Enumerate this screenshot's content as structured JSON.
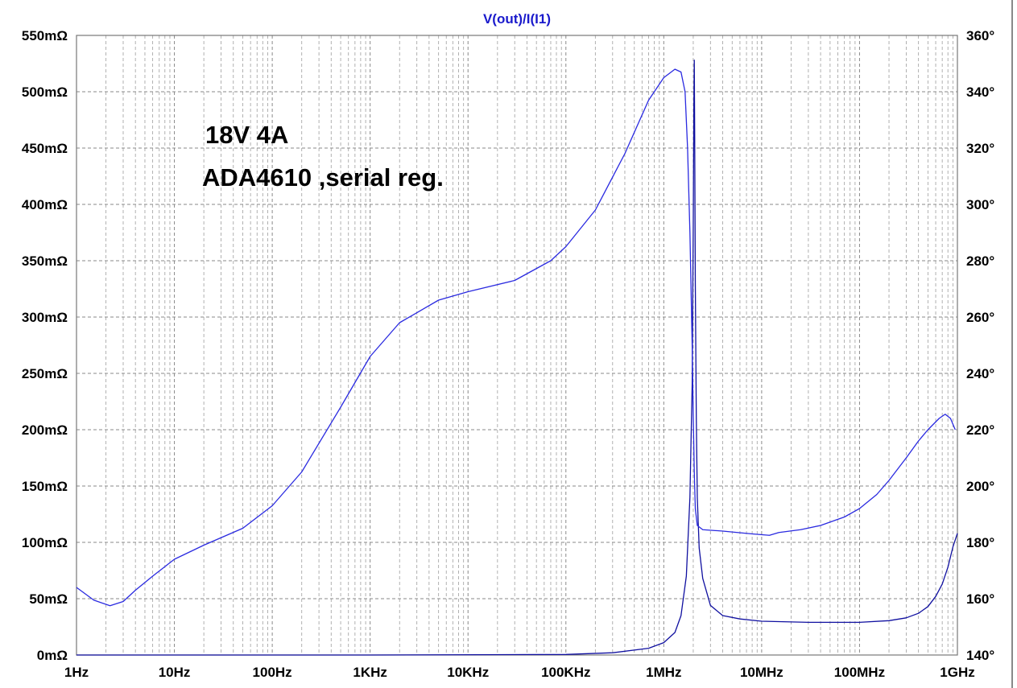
{
  "chart_data": {
    "type": "line",
    "title": "V(out)/I(I1)",
    "annotations": [
      "18V 4A",
      "ADA4610 ,serial reg."
    ],
    "x_scale": "log",
    "xlim": [
      1,
      1000000000
    ],
    "x_ticks": [
      {
        "value": 1,
        "label": "1Hz"
      },
      {
        "value": 10,
        "label": "10Hz"
      },
      {
        "value": 100,
        "label": "100Hz"
      },
      {
        "value": 1000,
        "label": "1KHz"
      },
      {
        "value": 10000,
        "label": "10KHz"
      },
      {
        "value": 100000,
        "label": "100KHz"
      },
      {
        "value": 1000000,
        "label": "1MHz"
      },
      {
        "value": 10000000,
        "label": "10MHz"
      },
      {
        "value": 100000000,
        "label": "100MHz"
      },
      {
        "value": 1000000000,
        "label": "1GHz"
      }
    ],
    "y_left": {
      "unit": "mΩ",
      "lim": [
        0,
        550
      ],
      "ticks": [
        {
          "value": 0,
          "label": "0mΩ"
        },
        {
          "value": 50,
          "label": "50mΩ"
        },
        {
          "value": 100,
          "label": "100mΩ"
        },
        {
          "value": 150,
          "label": "150mΩ"
        },
        {
          "value": 200,
          "label": "200mΩ"
        },
        {
          "value": 250,
          "label": "250mΩ"
        },
        {
          "value": 300,
          "label": "300mΩ"
        },
        {
          "value": 350,
          "label": "350mΩ"
        },
        {
          "value": 400,
          "label": "400mΩ"
        },
        {
          "value": 450,
          "label": "450mΩ"
        },
        {
          "value": 500,
          "label": "500mΩ"
        },
        {
          "value": 550,
          "label": "550mΩ"
        }
      ]
    },
    "y_right": {
      "unit": "°",
      "lim": [
        140,
        360
      ],
      "ticks": [
        {
          "value": 140,
          "label": "140°"
        },
        {
          "value": 160,
          "label": "160°"
        },
        {
          "value": 180,
          "label": "180°"
        },
        {
          "value": 200,
          "label": "200°"
        },
        {
          "value": 220,
          "label": "220°"
        },
        {
          "value": 240,
          "label": "240°"
        },
        {
          "value": 260,
          "label": "260°"
        },
        {
          "value": 280,
          "label": "280°"
        },
        {
          "value": 300,
          "label": "300°"
        },
        {
          "value": 320,
          "label": "320°"
        },
        {
          "value": 340,
          "label": "340°"
        },
        {
          "value": 360,
          "label": "360°"
        }
      ]
    },
    "grid": true,
    "series": [
      {
        "axis": "left",
        "color": "#1010a0",
        "style": "solid",
        "points": [
          [
            1,
            0
          ],
          [
            1000,
            0
          ],
          [
            100000,
            0.5
          ],
          [
            300000,
            2
          ],
          [
            700000,
            6
          ],
          [
            1000000,
            11
          ],
          [
            1300000,
            20
          ],
          [
            1500000,
            35
          ],
          [
            1700000,
            70
          ],
          [
            1850000,
            140
          ],
          [
            1950000,
            240
          ],
          [
            2000000,
            380
          ],
          [
            2030000,
            490
          ],
          [
            2050000,
            528
          ],
          [
            2070000,
            460
          ],
          [
            2100000,
            330
          ],
          [
            2150000,
            210
          ],
          [
            2200000,
            140
          ],
          [
            2300000,
            95
          ],
          [
            2500000,
            68
          ],
          [
            3000000,
            44
          ],
          [
            4000000,
            35
          ],
          [
            6000000,
            32
          ],
          [
            10000000,
            30
          ],
          [
            30000000,
            29
          ],
          [
            100000000,
            29
          ],
          [
            200000000,
            30.5
          ],
          [
            300000000,
            33
          ],
          [
            400000000,
            37
          ],
          [
            500000000,
            43
          ],
          [
            600000000,
            52
          ],
          [
            700000000,
            63
          ],
          [
            800000000,
            78
          ],
          [
            900000000,
            96
          ],
          [
            1000000000,
            108
          ]
        ]
      },
      {
        "axis": "right",
        "color": "#2a2ae0",
        "style": "solid",
        "points": [
          [
            1,
            164
          ],
          [
            1.5,
            159.5
          ],
          [
            2.2,
            157.5
          ],
          [
            3,
            159
          ],
          [
            4,
            163
          ],
          [
            6,
            168
          ],
          [
            10,
            174
          ],
          [
            20,
            179
          ],
          [
            50,
            185
          ],
          [
            100,
            193
          ],
          [
            200,
            205
          ],
          [
            500,
            228
          ],
          [
            1000,
            246
          ],
          [
            2000,
            258
          ],
          [
            5000,
            266
          ],
          [
            10000,
            269
          ],
          [
            30000,
            273
          ],
          [
            70000,
            280
          ],
          [
            100000,
            285
          ],
          [
            200000,
            298
          ],
          [
            400000,
            318
          ],
          [
            700000,
            337
          ],
          [
            1000000,
            345
          ],
          [
            1300000,
            348
          ],
          [
            1500000,
            347
          ],
          [
            1650000,
            340
          ],
          [
            1750000,
            320
          ],
          [
            1850000,
            290
          ],
          [
            1950000,
            250
          ],
          [
            2000000,
            225
          ],
          [
            2050000,
            205
          ],
          [
            2100000,
            192
          ],
          [
            2200000,
            186
          ],
          [
            2500000,
            184.5
          ],
          [
            4000000,
            184
          ],
          [
            8000000,
            183
          ],
          [
            12000000,
            182.5
          ],
          [
            15000000,
            183.5
          ],
          [
            25000000,
            184.5
          ],
          [
            40000000,
            186
          ],
          [
            70000000,
            189
          ],
          [
            100000000,
            192
          ],
          [
            150000000,
            197
          ],
          [
            200000000,
            202
          ],
          [
            300000000,
            210
          ],
          [
            400000000,
            216
          ],
          [
            500000000,
            220
          ],
          [
            650000000,
            224
          ],
          [
            750000000,
            225.5
          ],
          [
            850000000,
            224
          ],
          [
            950000000,
            220
          ]
        ]
      }
    ]
  }
}
